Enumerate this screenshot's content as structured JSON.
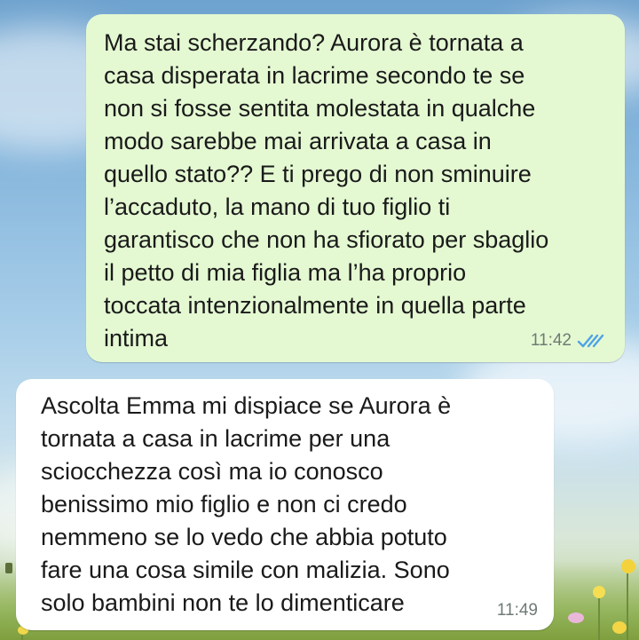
{
  "chat": {
    "messages": [
      {
        "direction": "outgoing",
        "lines": [
          "Ma stai scherzando? Aurora è tornata a",
          "casa disperata in lacrime secondo te se",
          "non si fosse sentita molestata in qualche",
          "modo sarebbe mai arrivata a casa in",
          "quello stato?? E ti prego di non sminuire",
          "l’accaduto, la mano di tuo figlio ti",
          "garantisco che non ha sfiorato per sbaglio",
          "il petto di mia figlia ma l’ha proprio",
          "toccata intenzionalmente in quella parte",
          "intima"
        ],
        "time": "11:42",
        "status_icon": "double-check-read-icon",
        "status_color": "#4fa3e6"
      },
      {
        "direction": "incoming",
        "lines": [
          "Ascolta Emma mi dispiace se Aurora è",
          "tornata a casa in lacrime per una",
          "sciocchezza così ma io conosco",
          "benissimo mio figlio e non ci credo",
          "nemmeno se lo vedo che abbia potuto",
          "fare una cosa simile con malizia. Sono",
          "solo bambini non te lo dimenticare"
        ],
        "time": "11:49"
      }
    ]
  },
  "colors": {
    "outgoing_bubble": "#e4f9d2",
    "incoming_bubble": "#ffffff",
    "timestamp": "#6f7b74"
  }
}
